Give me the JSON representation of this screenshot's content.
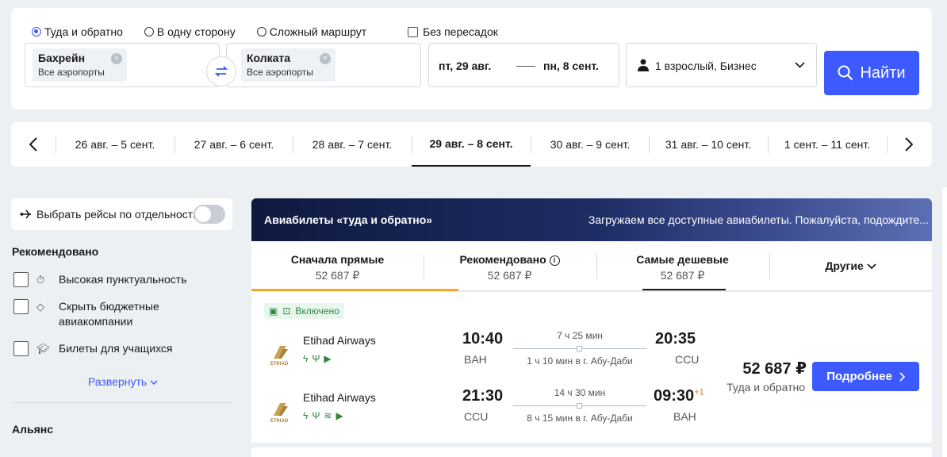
{
  "search": {
    "trip_types": [
      {
        "label": "Туда и обратно",
        "checked": true
      },
      {
        "label": "В одну сторону",
        "checked": false
      },
      {
        "label": "Сложный маршрут",
        "checked": false
      }
    ],
    "direct_only_label": "Без пересадок",
    "origin": {
      "city": "Бахрейн",
      "airports": "Все аэропорты"
    },
    "destination": {
      "city": "Колката",
      "airports": "Все аэропорты"
    },
    "depart_date": "пт, 29 авг.",
    "return_date": "пн, 8 сент.",
    "passengers": "1 взрослый, Бизнес",
    "search_button": "Найти"
  },
  "date_tabs": [
    {
      "label": "26 авг. – 5 сент.",
      "active": false
    },
    {
      "label": "27 авг. – 6 сент.",
      "active": false
    },
    {
      "label": "28 авг. – 7 сент.",
      "active": false
    },
    {
      "label": "29 авг. – 8 сент.",
      "active": true
    },
    {
      "label": "30 авг. – 9 сент.",
      "active": false
    },
    {
      "label": "31 авг. – 10 сент.",
      "active": false
    },
    {
      "label": "1 сент. – 11 сент.",
      "active": false
    }
  ],
  "sidebar": {
    "separate_flights_label": "Выбрать рейсы по отдельности",
    "recommended_heading": "Рекомендовано",
    "filters": [
      {
        "label": "Высокая пунктуальность",
        "icon": "stopwatch-icon"
      },
      {
        "label": "Скрыть бюджетные авиакомпании",
        "icon": "tag-icon"
      },
      {
        "label": "Билеты для учащихся",
        "icon": "graduation-cap-icon"
      }
    ],
    "expand_label": "Развернуть",
    "alliance_heading": "Альянс"
  },
  "results": {
    "banner_title": "Авиабилеты «туда и обратно»",
    "banner_loading": "Загружаем все доступные авиабилеты. Пожалуйста, подождите...",
    "sort_tabs": [
      {
        "label": "Сначала прямые",
        "price": "52 687 ₽"
      },
      {
        "label": "Рекомендовано",
        "price": "52 687 ₽"
      },
      {
        "label": "Самые дешевые",
        "price": "52 687 ₽"
      },
      {
        "label": "Другие",
        "price": ""
      }
    ],
    "ticket": {
      "included_label": "Включено",
      "price": "52 687 ₽",
      "price_note": "Туда и обратно",
      "details_button": "Подробнее",
      "legs": [
        {
          "airline": "Etihad Airways",
          "depart_time": "10:40",
          "depart_code": "BAH",
          "arrive_time": "20:35",
          "arrive_code": "CCU",
          "day_offset": "",
          "duration": "7 ч 25 мин",
          "stop_info": "1 ч 10 мин в г. Абу-Даби"
        },
        {
          "airline": "Etihad Airways",
          "depart_time": "21:30",
          "depart_code": "CCU",
          "arrive_time": "09:30",
          "arrive_code": "BAH",
          "day_offset": "+1",
          "duration": "14 ч 30 мин",
          "stop_info": "8 ч 15 мин в г. Абу-Даби"
        }
      ]
    }
  },
  "colors": {
    "accent": "#3d5afe",
    "sort_highlight": "#f5a623",
    "amenity_green": "#2e8540"
  }
}
